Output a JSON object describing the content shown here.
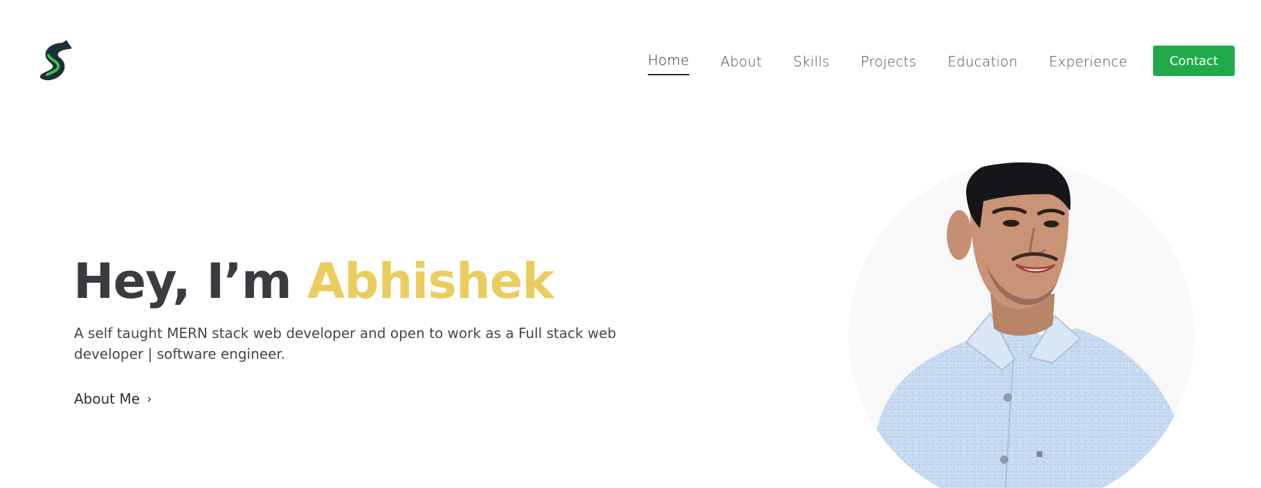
{
  "nav": {
    "logo_icon": "s-logo-icon",
    "links": [
      "Home",
      "About",
      "Skills",
      "Projects",
      "Education",
      "Experience"
    ],
    "active": "Home",
    "contact_label": "Contact",
    "accent_color": "#22a94a"
  },
  "hero": {
    "greeting": "Hey, I’m",
    "name": "Abhishek",
    "name_color": "#ebcc5f",
    "subtitle": "A self taught MERN stack web developer and open to work as a Full stack web developer | software engineer.",
    "cta_label": "About Me",
    "cta_icon": "chevron-right-icon"
  },
  "portrait": {
    "icon": "profile-photo"
  }
}
